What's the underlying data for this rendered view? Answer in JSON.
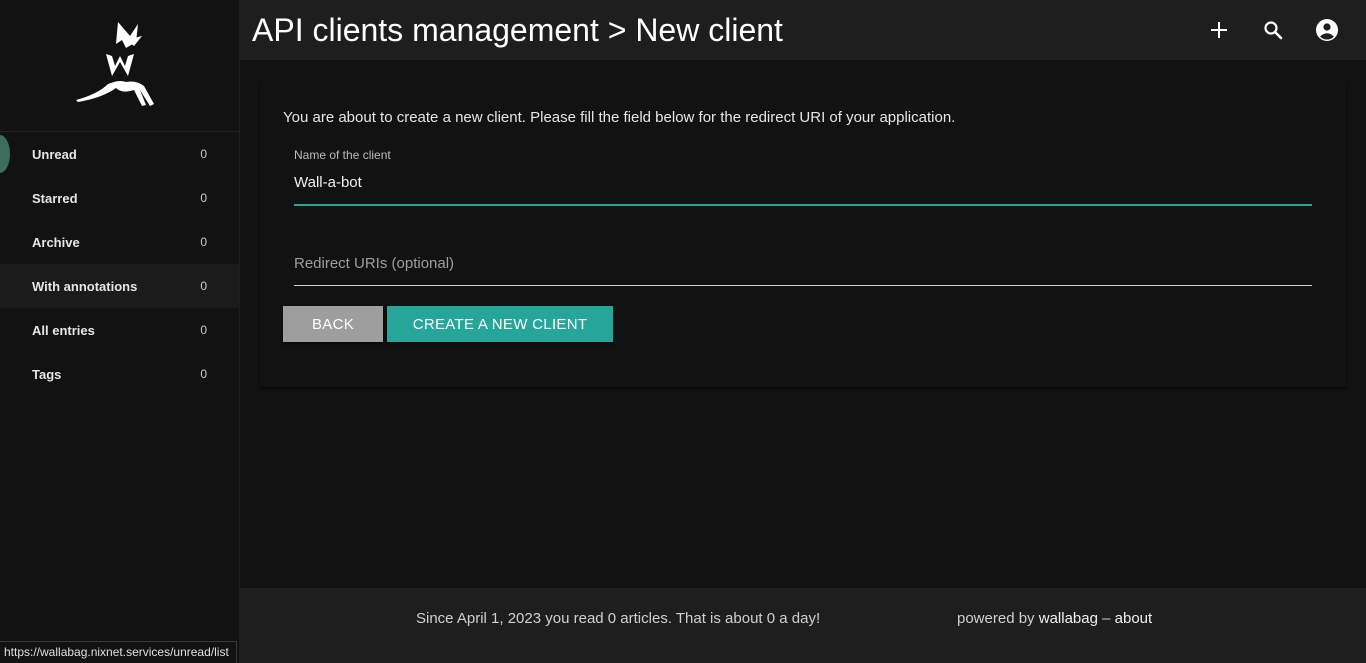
{
  "header": {
    "title": "API clients management > New client",
    "add_icon": "plus-icon",
    "search_icon": "search-icon",
    "account_icon": "account-circle-icon"
  },
  "sidebar": {
    "logo_icon": "wallabag-logo-icon",
    "items": [
      {
        "label": "Unread",
        "count": "0"
      },
      {
        "label": "Starred",
        "count": "0"
      },
      {
        "label": "Archive",
        "count": "0"
      },
      {
        "label": "With annotations",
        "count": "0"
      },
      {
        "label": "All entries",
        "count": "0"
      },
      {
        "label": "Tags",
        "count": "0"
      }
    ]
  },
  "form": {
    "intro": "You are about to create a new client. Please fill the field below for the redirect URI of your application.",
    "name_label": "Name of the client",
    "name_value": "Wall-a-bot",
    "uris_placeholder": "Redirect URIs (optional)",
    "back_label": "BACK",
    "create_label": "CREATE A NEW CLIENT"
  },
  "footer": {
    "stats": "Since April 1, 2023 you read 0 articles. That is about 0 a day!",
    "powered_by": "powered by",
    "wallabag_link": "wallabag",
    "separator": "–",
    "about_link": "about"
  },
  "statusbar": {
    "url": "https://wallabag.nixnet.services/unread/list"
  },
  "colors": {
    "accent": "#26a69a",
    "background": "#121212",
    "topbar": "#1e1e1e",
    "back_button": "#9e9e9e"
  }
}
